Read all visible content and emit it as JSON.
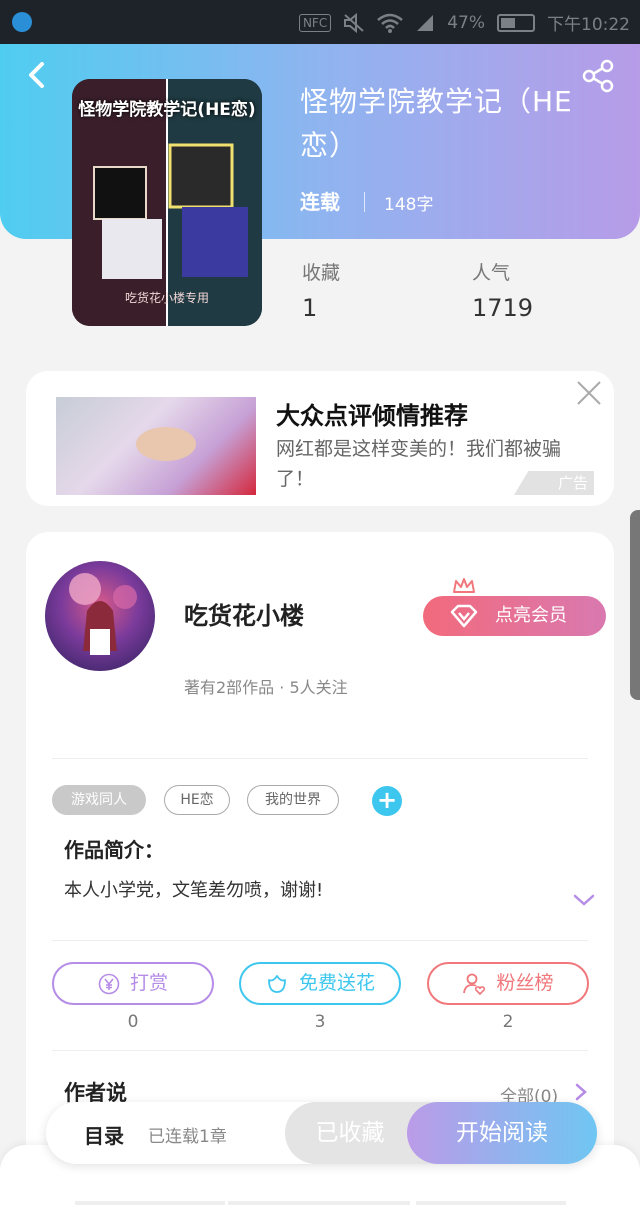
{
  "status_bar": {
    "nfc": "NFC",
    "battery_pct": "47%",
    "time": "下午10:22"
  },
  "book": {
    "title": "怪物学院教学记（HE恋）",
    "cover_title": "怪物学院教学记(HE恋)",
    "cover_footer": "吃货花小楼专用",
    "status": "连载",
    "word_count": "148字"
  },
  "stats": {
    "favorites_label": "收藏",
    "favorites_value": "1",
    "popularity_label": "人气",
    "popularity_value": "1719"
  },
  "ad": {
    "title": "大众点评倾情推荐",
    "desc": "网红都是这样变美的！我们都被骗了！",
    "badge": "广告"
  },
  "author": {
    "name": "吃货花小楼",
    "meta": "著有2部作品 · 5人关注",
    "vip_label": "点亮会员"
  },
  "tags": [
    "游戏同人",
    "HE恋",
    "我的世界"
  ],
  "tag_add": "+",
  "intro": {
    "title": "作品简介：",
    "text": "本人小学党，文笔差勿喷，谢谢!"
  },
  "actions": [
    {
      "label": "打赏",
      "count": "0",
      "color": "#b58ce6"
    },
    {
      "label": "免费送花",
      "count": "3",
      "color": "#3ec7ee"
    },
    {
      "label": "粉丝榜",
      "count": "2",
      "color": "#f0777b"
    }
  ],
  "author_says": {
    "title": "作者说",
    "all": "全部(0)"
  },
  "bottom_bar": {
    "toc": "目录",
    "toc_meta": "已连载1章",
    "collected": "已收藏",
    "read": "开始阅读"
  }
}
